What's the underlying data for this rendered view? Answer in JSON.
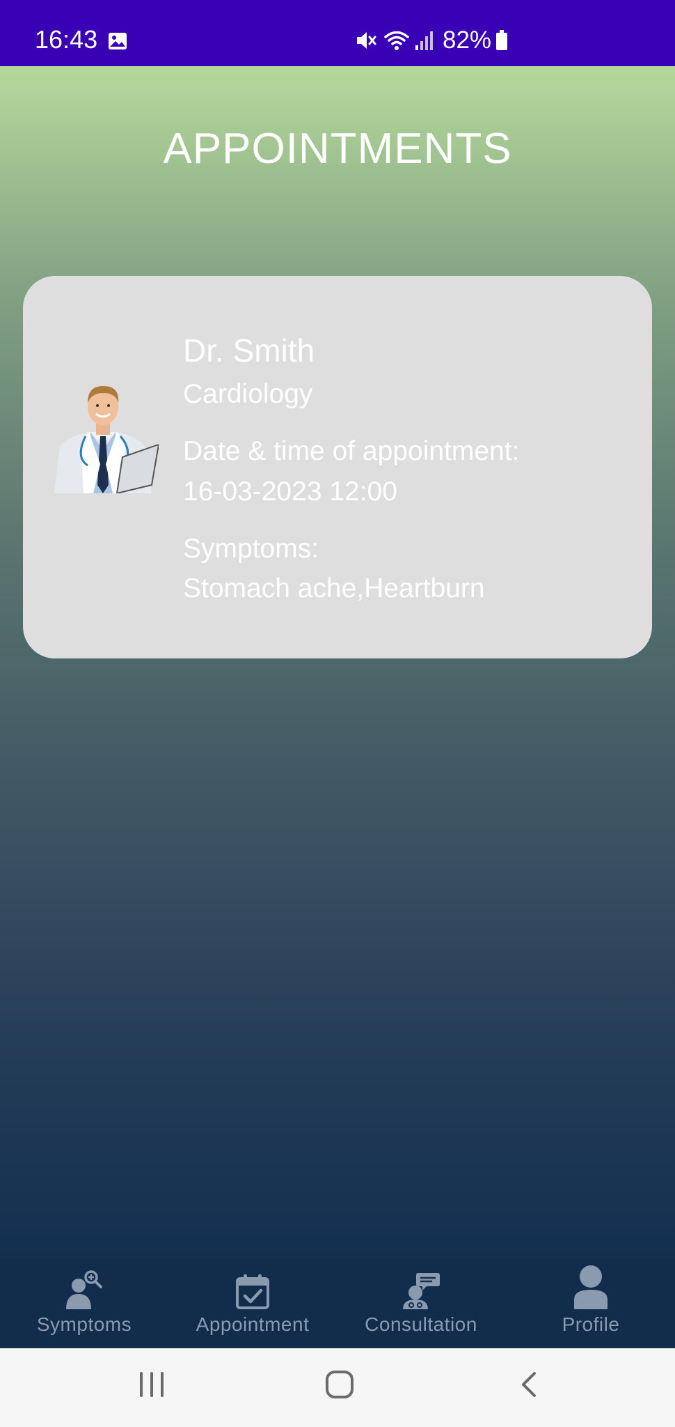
{
  "status_bar": {
    "time": "16:43",
    "battery": "82%",
    "icons": [
      "image-icon",
      "mute-icon",
      "wifi-icon",
      "signal-icon",
      "battery-icon"
    ]
  },
  "page": {
    "title": "APPOINTMENTS"
  },
  "appointment": {
    "doctor_name": "Dr. Smith",
    "specialty": "Cardiology",
    "datetime_label": "Date & time of appointment:",
    "datetime_value": "16-03-2023 12:00",
    "symptoms_label": "Symptoms:",
    "symptoms_value": "Stomach ache,Heartburn"
  },
  "bottom_nav": {
    "items": [
      {
        "label": "Symptoms",
        "icon": "symptoms-search-icon"
      },
      {
        "label": "Appointment",
        "icon": "calendar-check-icon"
      },
      {
        "label": "Consultation",
        "icon": "consultation-chat-icon"
      },
      {
        "label": "Profile",
        "icon": "profile-icon"
      }
    ]
  },
  "colors": {
    "status_bar": "#3a00b6",
    "gradient_top": "#b5d99b",
    "gradient_bottom": "#132f50",
    "card": "#dedede",
    "nav_bg": "#122c4b",
    "nav_label": "#8a9bb0"
  }
}
